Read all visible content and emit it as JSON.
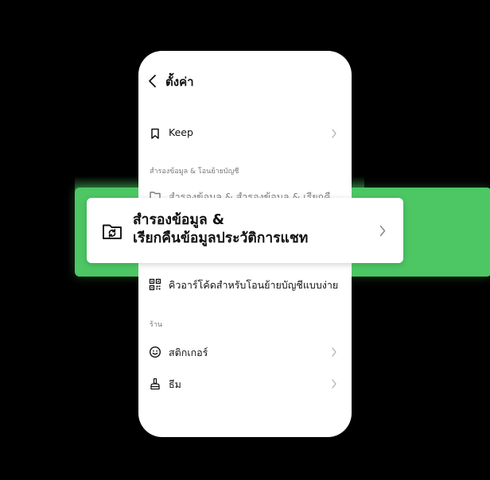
{
  "header": {
    "title": "ตั้งค่า"
  },
  "rows": {
    "keep": {
      "label": "Keep"
    },
    "qr_transfer": {
      "label": "คิวอาร์โค้ดสำหรับโอนย้ายบัญชีแบบง่าย"
    },
    "stickers": {
      "label": "สติกเกอร์"
    },
    "themes": {
      "label": "ธีม"
    }
  },
  "sections": {
    "backup_transfer": "สำรองข้อมูล & โอนย้ายบัญชี",
    "shop": "ร้าน"
  },
  "ghost_row": {
    "label": "สำรองข้อมูล & สำรองข้อมูล & เรียกคื"
  },
  "highlight": {
    "line1": "สำรองข้อมูล &",
    "line2": "เรียกคืนข้อมูลประวัติการแชท"
  },
  "colors": {
    "accent_green": "#4cc764",
    "background": "#000000",
    "text": "#111111",
    "muted": "#777777"
  },
  "icons": {
    "back": "chevron-left-icon",
    "keep": "bookmark-icon",
    "backup": "folder-sync-icon",
    "qr": "qr-code-icon",
    "sticker": "smiley-icon",
    "theme": "brush-icon",
    "chevron": "chevron-right-icon"
  }
}
